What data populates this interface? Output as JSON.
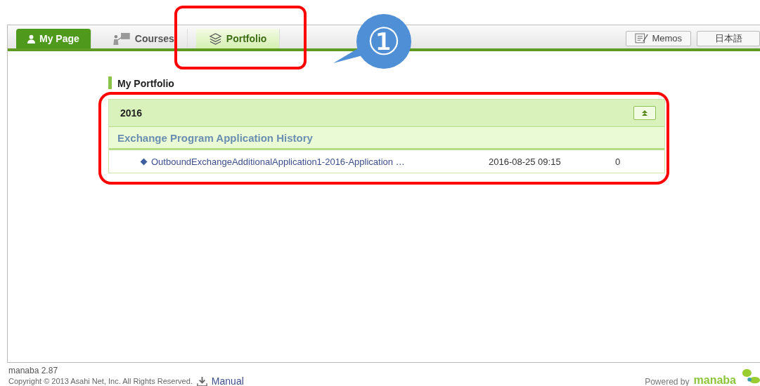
{
  "tabs": [
    {
      "label": "My Page",
      "kind": "home",
      "selected": false
    },
    {
      "label": "Courses",
      "kind": "courses",
      "selected": false
    },
    {
      "label": "Portfolio",
      "kind": "portfolio",
      "selected": true
    }
  ],
  "header_buttons": [
    {
      "label": "Memos",
      "kind": "memo"
    },
    {
      "label": "日本語",
      "kind": "plain"
    }
  ],
  "section_title": "My Portfolio",
  "portfolio": {
    "year": "2016",
    "category": "Exchange Program Application History",
    "rows": [
      {
        "title": "OutboundExchangeAdditionalApplication1-2016-Application …",
        "date": "2016-08-25 09:15",
        "count": "0"
      }
    ]
  },
  "callout": "①",
  "footer": {
    "version": "manaba 2.87",
    "copyright": "Copyright © 2013 Asahi Net, Inc. All Rights Reserved.",
    "manual": "Manual",
    "powered_by": "Powered by",
    "brand": "manaba"
  }
}
